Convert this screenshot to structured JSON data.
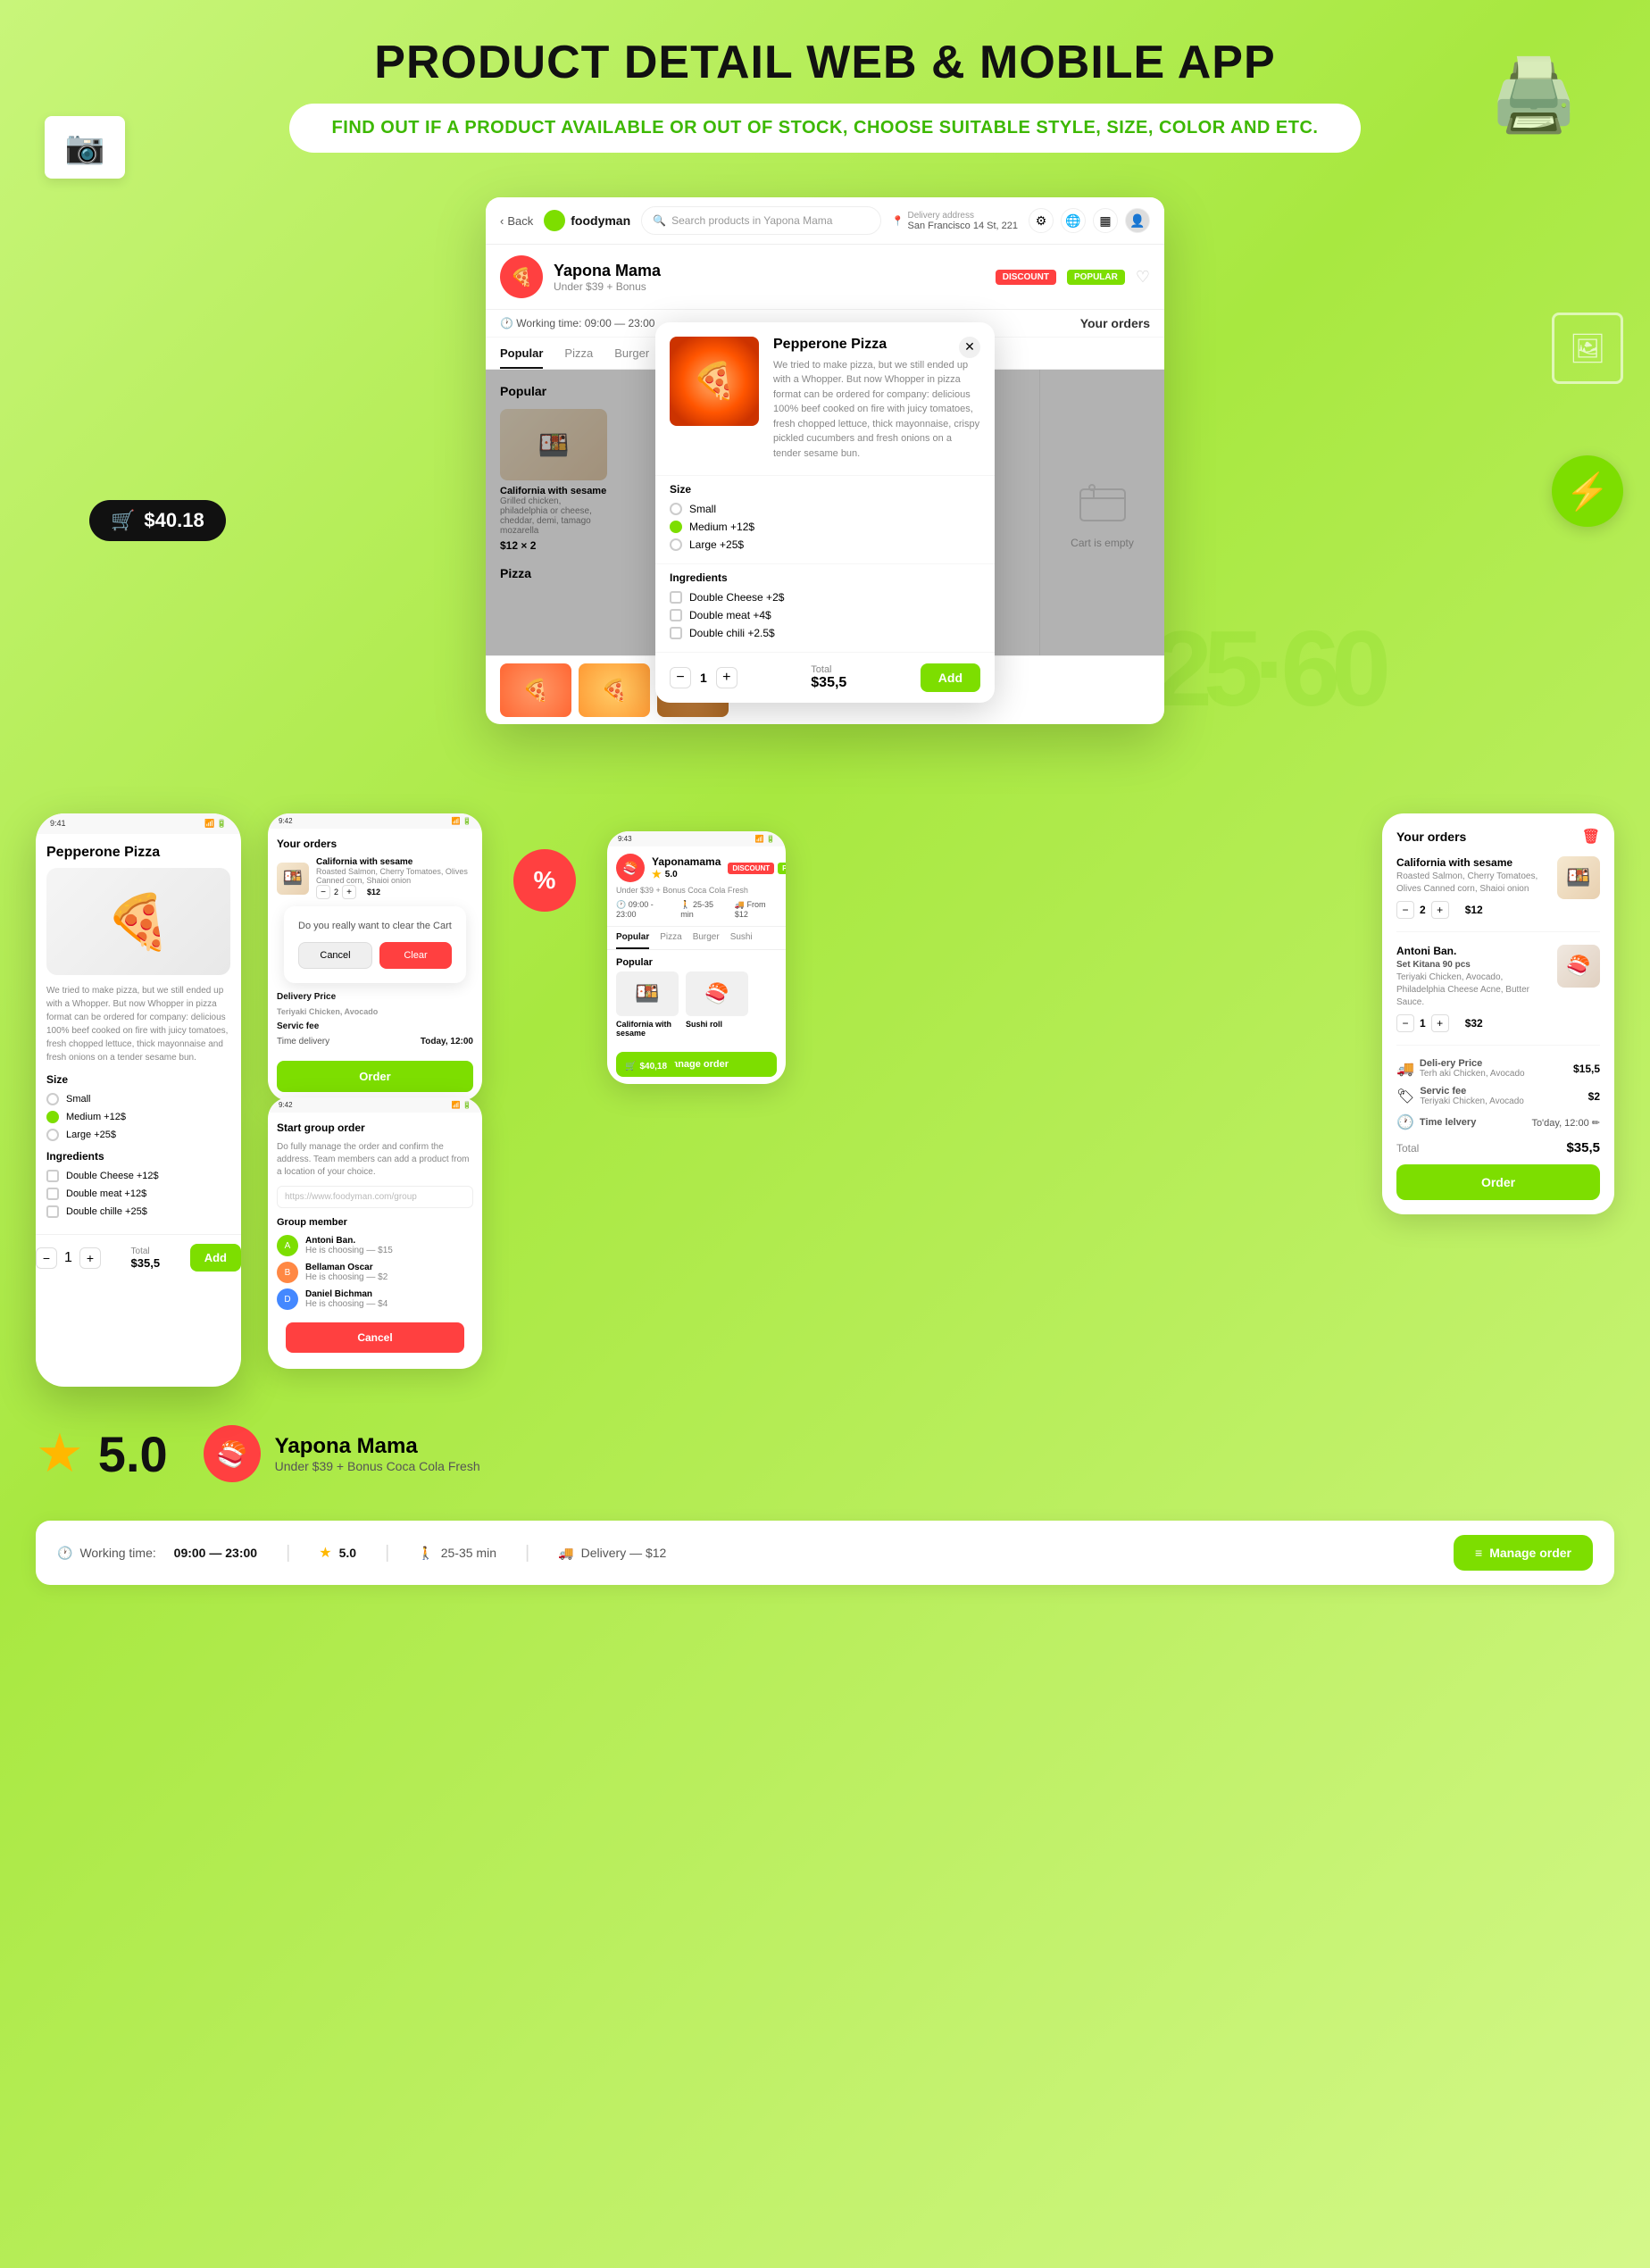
{
  "page": {
    "title": "PRODUCT DETAIL WEB & MOBILE APP",
    "subtitle": "FIND OUT IF A PRODUCT AVAILABLE OR OUT OF STOCK, CHOOSE SUITABLE STYLE, SIZE, COLOR AND ETC."
  },
  "nav": {
    "back": "Back",
    "logo": "foodyman",
    "search_placeholder": "Search products in Yapona Mama",
    "delivery_label": "Delivery address",
    "delivery_address": "San Francisco 14 St, 221"
  },
  "restaurant": {
    "name": "Yapona Mama",
    "sub": "Under $39 + Bonus",
    "working_time": "Working time: 09:00 — 23:00",
    "badge_discount": "DISCOUNT",
    "badge_popular": "POPULAR"
  },
  "tabs": [
    "Popular",
    "Pizza",
    "Burger",
    "Sushi"
  ],
  "sections": {
    "popular": "Popular",
    "pizza": "Pizza"
  },
  "cart": {
    "title": "Your orders",
    "empty_text": "Cart is empty"
  },
  "modal": {
    "title": "Pepperone Pizza",
    "description": "We tried to make pizza, but we still ended up with a Whopper. But now Whopper in pizza format can be ordered for company: delicious 100% beef cooked on fire with juicy tomatoes, fresh chopped lettuce, thick mayonnaise, crispy pickled cucumbers and fresh onions on a tender sesame bun.",
    "size_label": "Size",
    "sizes": [
      {
        "label": "Small",
        "selected": false
      },
      {
        "label": "Medium +12$",
        "selected": true
      },
      {
        "label": "Large +25$",
        "selected": false
      }
    ],
    "ingredients_label": "Ingredients",
    "ingredients": [
      {
        "label": "Double Cheese +2$",
        "checked": false
      },
      {
        "label": "Double meat +4$",
        "checked": false
      },
      {
        "label": "Double chili +2.5$",
        "checked": false
      }
    ],
    "quantity": 1,
    "total_label": "Total",
    "total_price": "$35,5",
    "add_btn": "Add"
  },
  "product_california": {
    "name": "California with sesame",
    "desc": "Grilled chicken, philadelphia or cheese, cheddar, demi, tamago mozarella",
    "price": "$12",
    "qty": "2"
  },
  "mobile_main": {
    "status_time": "9:41",
    "product_title": "Pepperone Pizza",
    "description": "We tried to make pizza, but we still ended up with a Whopper. But now Whopper in pizza format can be ordered for company: delicious 100% beef cooked on fire with juicy tomatoes, fresh chopped lettuce, thick mayonnaise and fresh onions on a tender sesame bun.",
    "size_label": "Size",
    "sizes": [
      "Small",
      "Medium +12$",
      "Large +25$"
    ],
    "ingredients_label": "Ingredients",
    "ingredients": [
      "Double Cheese +12$",
      "Double meat +12$",
      "Double chille +25$"
    ],
    "qty": 1,
    "total_label": "Total",
    "total": "$35,5",
    "add_btn": "Add"
  },
  "mobile_orders": {
    "status_time": "9:42",
    "title": "Your orders",
    "items": [
      {
        "name": "California with sesame",
        "desc": "Roasted Salmon, Cherry Tomatoes, Olives Canned corn, Shaioi onion",
        "qty": 2,
        "price": "$12"
      }
    ],
    "clear_dialog": "Do you really want to clear the Cart",
    "cancel_btn": "Cancel",
    "clear_btn": "Clear",
    "delivery_price_label": "Delivery Price",
    "delivery_price_sub": "Teriyaki Chicken, Avocado",
    "service_fee_label": "Servic fee",
    "service_fee_sub": "Teriyaki Chicken, Avocado",
    "time_delivery_label": "Time delivery",
    "time_delivery_value": "Today, 12:00",
    "order_btn": "Order"
  },
  "group_order": {
    "status_time": "9:42",
    "title": "Start group order",
    "description": "Do fully manage the order and confirm the address. Team members can add a product from a location of your choice.",
    "url_placeholder": "https://www.foodyman.com/group",
    "members_label": "Group member",
    "members": [
      {
        "name": "Antoni Ban.",
        "status": "He is choosing — $15"
      },
      {
        "name": "Bellaman Oscar",
        "status": "He is choosing — $2"
      },
      {
        "name": "Daniel Bichman",
        "status": "He is choosing — $4"
      }
    ],
    "cancel_btn": "Cancel"
  },
  "yapona_phone": {
    "status_time": "9:43",
    "name": "Yaponamama",
    "rating": "5.0",
    "sub": "Under $39 + Bonus Coca Cola Fresh",
    "working_hours": "09:00 - 23:00",
    "delivery_time": "25-35 min",
    "delivery_price": "From $12",
    "tabs": [
      "Popular",
      "Pizza",
      "Burger",
      "Sushi"
    ],
    "popular_label": "Popular",
    "badge_discount": "DISCOUNT",
    "badge_popular": "POPULAR",
    "popular_items": [
      "California with sesame"
    ],
    "cart_badge": "$40,18",
    "manage_order_btn": "Manage order"
  },
  "right_panel": {
    "title": "Your orders",
    "items": [
      {
        "name": "California with sesame",
        "desc": "Roasted Salmon, Cherry Tomatoes, Olives Canned corn, Shaioi onion",
        "qty": 2,
        "price": "$12"
      },
      {
        "name": "Antoni Ban.",
        "sub_item": "Set Kitana 90 pcs",
        "sub_desc": "Teriyaki Chicken, Avocado, Philadelphia Cheese Acne, Butter Sauce.",
        "qty": 1,
        "price": "$32"
      }
    ],
    "delivery_price_label": "Deli-ery Price",
    "delivery_price_value": "$15,5",
    "delivery_price_sub": "Terh aki Chicken, Avocado",
    "service_fee_label": "Servic fee",
    "service_fee_value": "$2",
    "service_fee_sub": "Teriyaki Chicken, Avocado",
    "time_delivery_label": "Time lelvery",
    "time_delivery_value": "To'day, 12:00",
    "total_label": "Total",
    "total_value": "$35,5",
    "order_btn": "Order"
  },
  "rating": {
    "value": "5.0",
    "star": "★"
  },
  "restaurant_bottom": {
    "name": "Yapona Mama",
    "sub": "Under $39 + Bonus Coca Cola Fresh"
  },
  "bottom_bar": {
    "working_time_label": "Working time:",
    "working_time": "09:00 — 23:00",
    "rating": "5.0",
    "walk_time": "25-35 min",
    "delivery": "Delivery — $12",
    "manage_btn": "Manage order"
  },
  "deco": {
    "cart_amount": "$40.18",
    "big_numbers": "25·60"
  }
}
